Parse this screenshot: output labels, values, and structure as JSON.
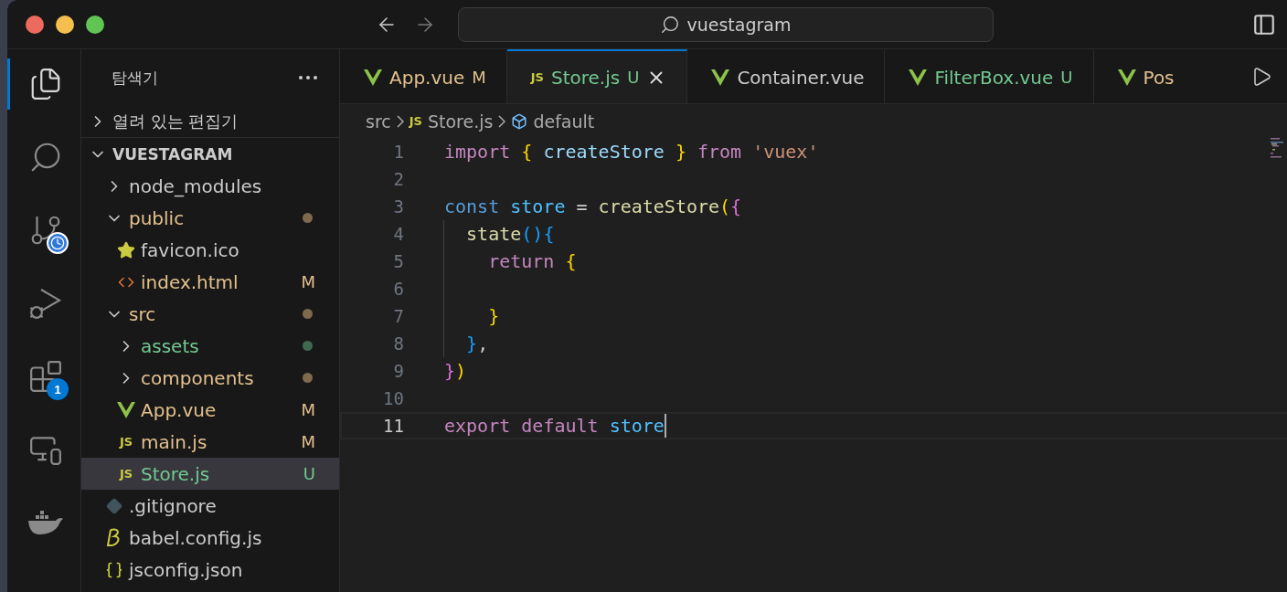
{
  "title_bar": {
    "search": "vuestagram"
  },
  "activity_bar": [
    {
      "kind": "files",
      "selected": true
    },
    {
      "kind": "search",
      "selected": false
    },
    {
      "kind": "source-control",
      "selected": false
    },
    {
      "kind": "run-debug",
      "selected": false
    },
    {
      "kind": "extensions",
      "selected": false,
      "badge": "1"
    },
    {
      "kind": "remote",
      "selected": false
    },
    {
      "kind": "docker",
      "selected": false
    }
  ],
  "explorer": {
    "title": "탐색기",
    "open_editors": {
      "title": "열려 있는 편집기",
      "expanded": false
    },
    "project": {
      "title": "VUESTAGRAM",
      "expanded": true,
      "children": [
        {
          "name": "node_modules",
          "kind": "folder",
          "expanded": false,
          "color": "#cccccc",
          "selected": false
        },
        {
          "name": "public",
          "kind": "folder",
          "expanded": true,
          "color": "#e2c08d",
          "dot": {
            "color": "#7d6a4f"
          },
          "selected": false,
          "children": [
            {
              "name": "favicon.ico",
              "kind": "favicon",
              "color": "#cccccc",
              "selected": false
            },
            {
              "name": "index.html",
              "kind": "html",
              "color": "#e2c08d",
              "badge": "M",
              "selected": false
            }
          ]
        },
        {
          "name": "src",
          "kind": "folder",
          "expanded": true,
          "color": "#e2c08d",
          "dot": {
            "color": "#7d6a4f"
          },
          "selected": false,
          "children": [
            {
              "name": "assets",
              "kind": "folder",
              "expanded": false,
              "color": "#73c991",
              "dot": {
                "color": "#3f6a4e"
              },
              "selected": false
            },
            {
              "name": "components",
              "kind": "folder",
              "expanded": false,
              "color": "#e2c08d",
              "dot": {
                "color": "#7d6a4f"
              },
              "selected": false
            },
            {
              "name": "App.vue",
              "kind": "vue",
              "color": "#e2c08d",
              "badge": "M",
              "selected": false
            },
            {
              "name": "main.js",
              "kind": "js",
              "icon_text": "JS",
              "color": "#e2c08d",
              "badge": "M",
              "selected": false
            },
            {
              "name": "Store.js",
              "kind": "js",
              "icon_text": "JS",
              "color": "#73c991",
              "badge": "U",
              "selected": true
            }
          ]
        },
        {
          "name": ".gitignore",
          "kind": "gitignore",
          "color": "#cccccc",
          "selected": false
        },
        {
          "name": "babel.config.js",
          "kind": "babel",
          "color": "#cccccc",
          "selected": false
        },
        {
          "name": "jsconfig.json",
          "kind": "json",
          "color": "#cccccc",
          "selected": false
        }
      ]
    }
  },
  "tabs": [
    {
      "label": "App.vue",
      "kind": "vue",
      "color": "#e2c08d",
      "badge": "M",
      "selected": false
    },
    {
      "label": "Store.js",
      "kind": "js",
      "icon_text": "JS",
      "color": "#73c991",
      "badge": "U",
      "selected": true
    },
    {
      "label": "Container.vue",
      "kind": "vue",
      "color": "#cccccc",
      "selected": false
    },
    {
      "label": "FilterBox.vue",
      "kind": "vue",
      "color": "#73c991",
      "badge": "U",
      "selected": false
    },
    {
      "label": "Pos",
      "kind": "vue",
      "color": "#e2c08d",
      "selected": false
    }
  ],
  "breadcrumb": [
    {
      "label": "src",
      "kind": "folder"
    },
    {
      "label": "Store.js",
      "kind": "js",
      "icon_text": "JS"
    },
    {
      "label": "default",
      "kind": "symbol"
    }
  ],
  "code": [
    {
      "number": "1",
      "current": false,
      "guide": false,
      "tokens": [
        {
          "text": "import ",
          "kind": "keyword"
        },
        {
          "text": "{ ",
          "kind": "bracket1"
        },
        {
          "text": "createStore ",
          "kind": "variable"
        },
        {
          "text": "} ",
          "kind": "bracket1"
        },
        {
          "text": "from ",
          "kind": "keyword"
        },
        {
          "text": "'vuex'",
          "kind": "string"
        }
      ]
    },
    {
      "number": "2",
      "current": false,
      "guide": false
    },
    {
      "number": "3",
      "current": false,
      "guide": false,
      "tokens": [
        {
          "text": "const ",
          "kind": "storage"
        },
        {
          "text": "store",
          "kind": "constant"
        },
        {
          "text": " = ",
          "kind": "plain"
        },
        {
          "text": "createStore",
          "kind": "function"
        },
        {
          "text": "(",
          "kind": "bracket1"
        },
        {
          "text": "{",
          "kind": "bracket2"
        }
      ]
    },
    {
      "number": "4",
      "current": false,
      "guide": true,
      "tokens": [
        {
          "text": "  state",
          "kind": "function"
        },
        {
          "text": "(){",
          "kind": "bracket3"
        }
      ]
    },
    {
      "number": "5",
      "current": false,
      "guide": true,
      "tokens": [
        {
          "text": "    return ",
          "kind": "keyword"
        },
        {
          "text": "{",
          "kind": "bracket1"
        }
      ]
    },
    {
      "number": "6",
      "current": false,
      "guide": true
    },
    {
      "number": "7",
      "current": false,
      "guide": true,
      "tokens": [
        {
          "text": "    }",
          "kind": "bracket1"
        }
      ]
    },
    {
      "number": "8",
      "current": false,
      "guide": true,
      "tokens": [
        {
          "text": "  }",
          "kind": "bracket3"
        },
        {
          "text": ",",
          "kind": "plain"
        }
      ]
    },
    {
      "number": "9",
      "current": false,
      "guide": false,
      "tokens": [
        {
          "text": "}",
          "kind": "bracket2"
        },
        {
          "text": ")",
          "kind": "bracket1"
        }
      ]
    },
    {
      "number": "10",
      "current": false,
      "guide": false
    },
    {
      "number": "11",
      "current": true,
      "guide": false,
      "cursor": true,
      "tokens": [
        {
          "text": "export ",
          "kind": "keyword"
        },
        {
          "text": "default ",
          "kind": "keyword"
        },
        {
          "text": "store",
          "kind": "constant"
        }
      ]
    }
  ]
}
